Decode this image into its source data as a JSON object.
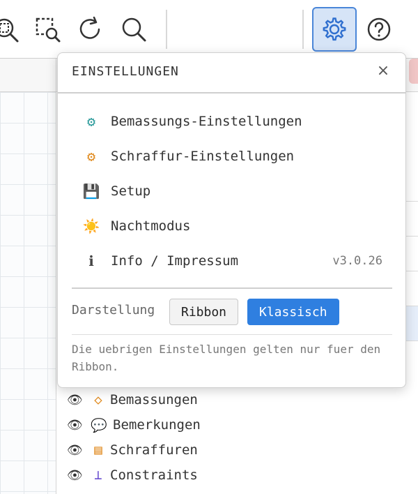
{
  "toolbar": {
    "icons": [
      "zoom-extents-icon",
      "zoom-window-icon",
      "redo-icon",
      "search-icon",
      "settings-gear-icon",
      "help-icon"
    ],
    "accent_color": "#4a86d8"
  },
  "settings_popup": {
    "title": "EINSTELLUNGEN",
    "close": "×",
    "items": [
      {
        "icon": "⚙",
        "label": "Bemassungs-Einstellungen",
        "icon_color": "#2a9a9a"
      },
      {
        "icon": "⚙",
        "label": "Schraffur-Einstellungen",
        "icon_color": "#e08a1e"
      },
      {
        "icon": "💾",
        "label": "Setup"
      },
      {
        "icon": "☀️",
        "label": "Nachtmodus"
      },
      {
        "icon": "ℹ",
        "label": "Info / Impressum",
        "version": "v3.0.26"
      }
    ],
    "view_label": "Darstellung",
    "view_options": [
      "Ribbon",
      "Klassisch"
    ],
    "view_selected": "Klassisch",
    "note": "Die uebrigen Einstellungen gelten nur fuer den Ribbon."
  },
  "layers": [
    {
      "eye": "👁",
      "icon": "◇",
      "icon_color": "#e08a1e",
      "label": "Bemassungen"
    },
    {
      "eye": "👁",
      "icon": "💬",
      "icon_color": "#333333",
      "label": "Bemerkungen"
    },
    {
      "eye": "👁",
      "icon": "▤",
      "icon_color": "#e08a1e",
      "label": "Schraffuren"
    },
    {
      "eye": "👁",
      "icon": "⊥",
      "icon_color": "#6a4fd0",
      "label": "Constraints"
    }
  ]
}
